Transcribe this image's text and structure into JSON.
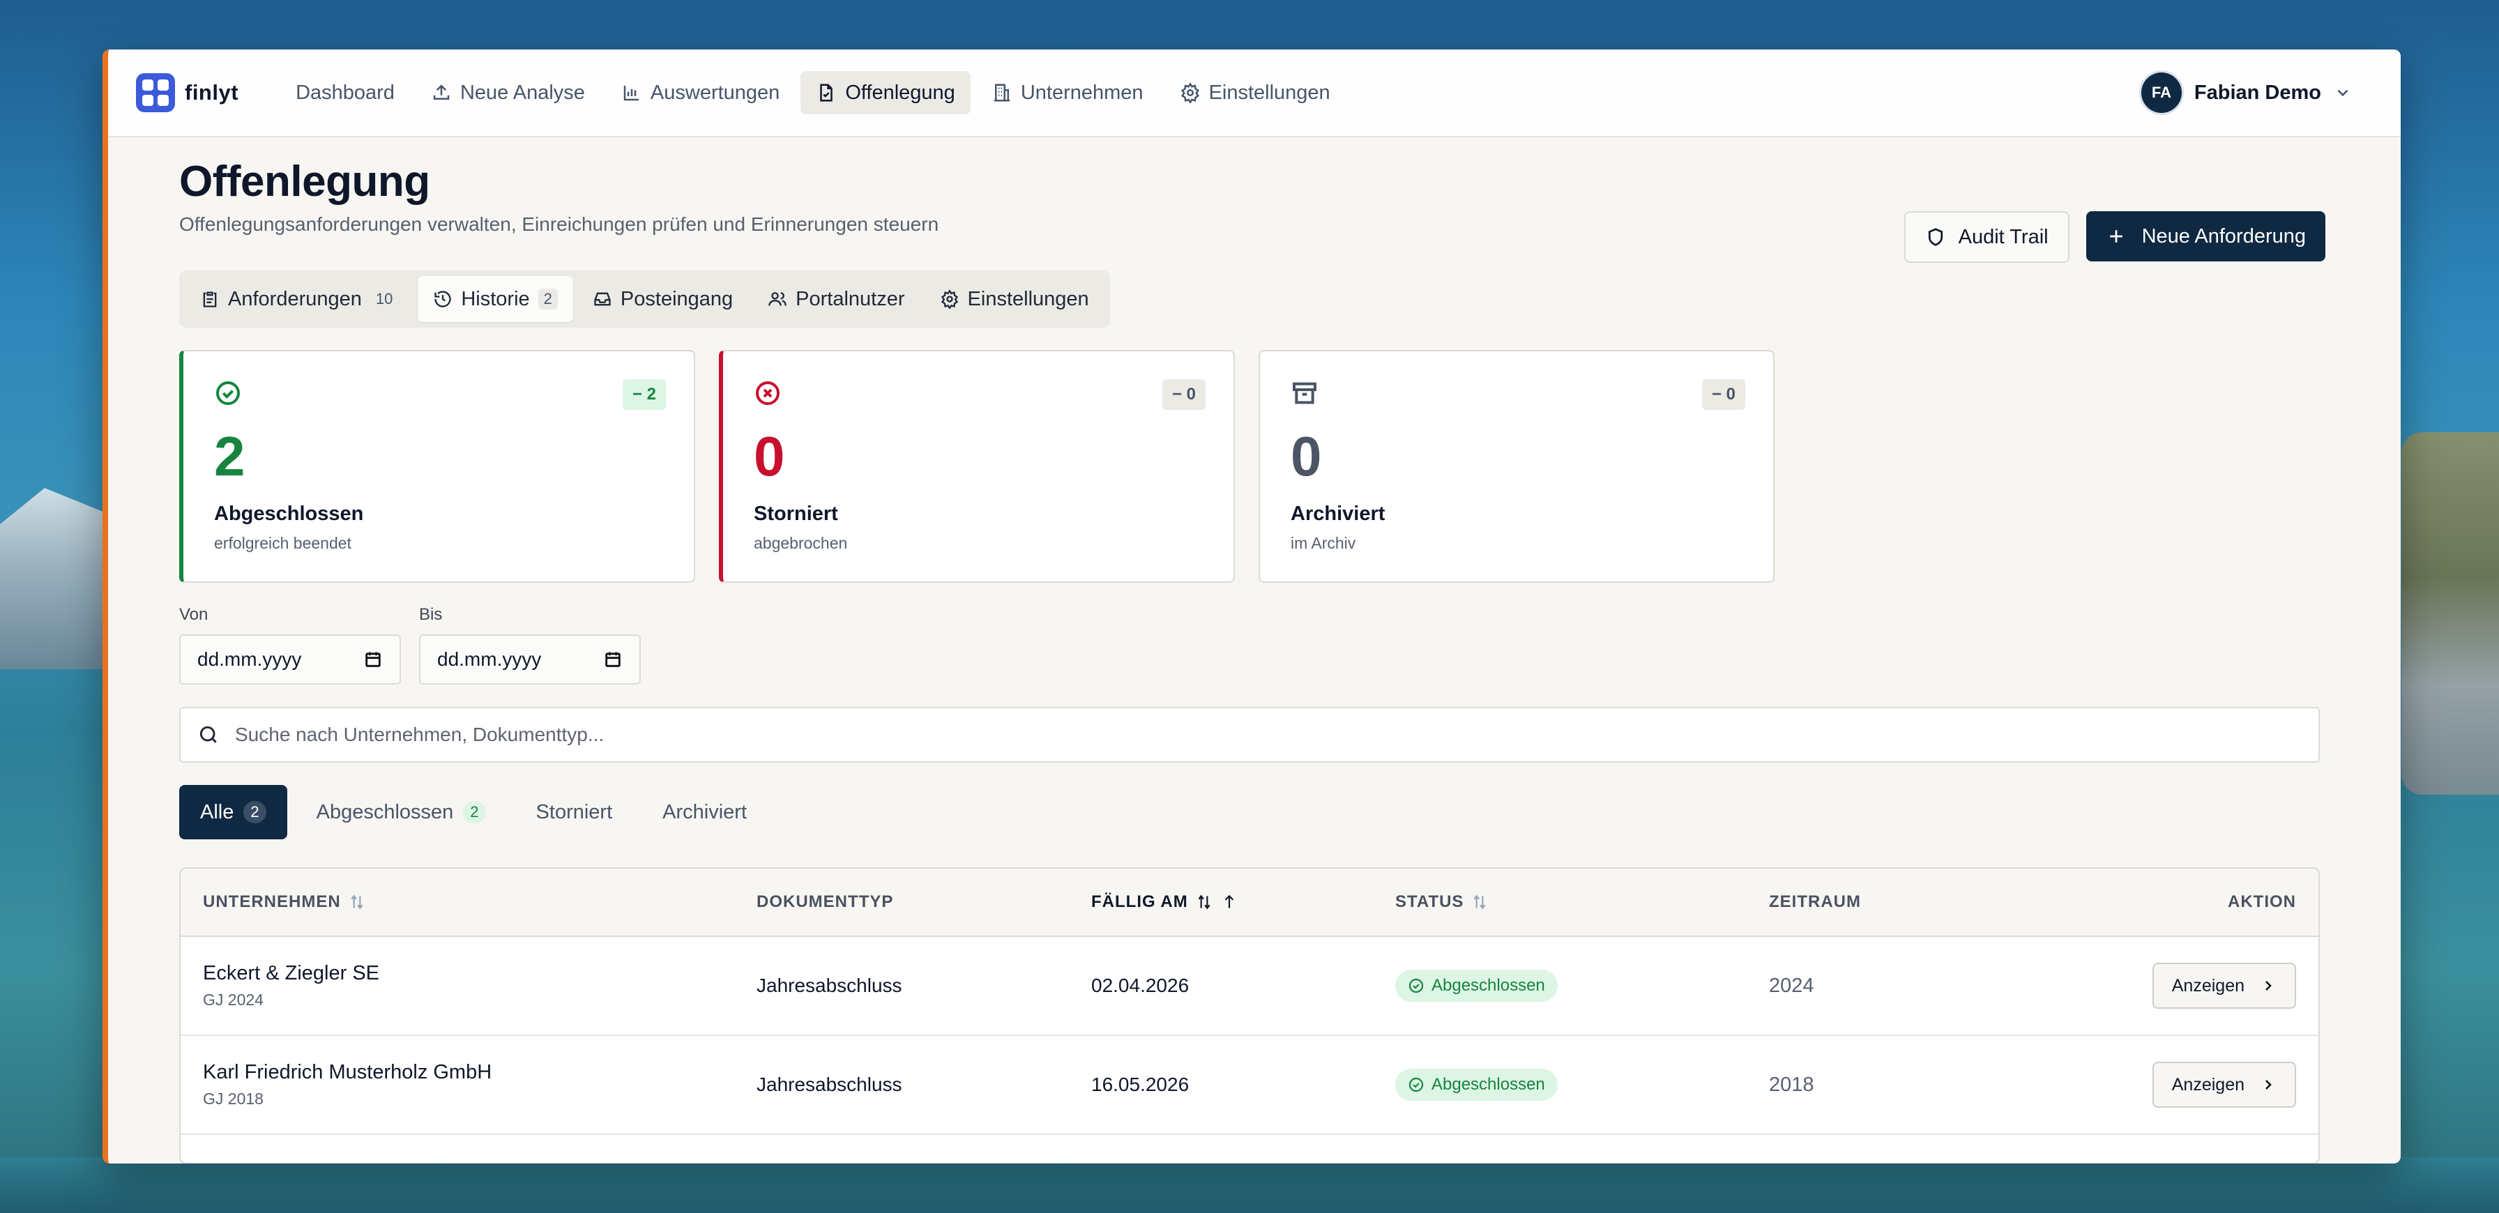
{
  "app": {
    "logo_text": "finlyt"
  },
  "nav": {
    "items": [
      {
        "label": "Dashboard",
        "icon": "none"
      },
      {
        "label": "Neue Analyse",
        "icon": "upload-icon"
      },
      {
        "label": "Auswertungen",
        "icon": "bar-chart-icon"
      },
      {
        "label": "Offenlegung",
        "icon": "file-check-icon",
        "active": true
      },
      {
        "label": "Unternehmen",
        "icon": "building-icon"
      },
      {
        "label": "Einstellungen",
        "icon": "gear-icon"
      }
    ]
  },
  "user": {
    "initials": "FA",
    "name": "Fabian Demo"
  },
  "page": {
    "title": "Offenlegung",
    "subtitle": "Offenlegungsanforderungen verwalten, Einreichungen prüfen und Erinnerungen steuern",
    "audit_label": "Audit Trail",
    "new_request_label": "Neue Anforderung"
  },
  "subtabs": [
    {
      "label": "Anforderungen",
      "count": "10"
    },
    {
      "label": "Historie",
      "count": "2",
      "active": true
    },
    {
      "label": "Posteingang",
      "count": ""
    },
    {
      "label": "Portalnutzer",
      "count": ""
    },
    {
      "label": "Einstellungen",
      "count": ""
    }
  ],
  "cards": [
    {
      "badge": "− 2",
      "value": "2",
      "label": "Abgeschlossen",
      "sub": "erfolgreich beendet",
      "color": "#16843f"
    },
    {
      "badge": "− 0",
      "value": "0",
      "label": "Storniert",
      "sub": "abgebrochen",
      "color": "#c8102e"
    },
    {
      "badge": "− 0",
      "value": "0",
      "label": "Archiviert",
      "sub": "im Archiv",
      "color": "#4b5563"
    }
  ],
  "dates": {
    "from_label": "Von",
    "from_value": "dd.mm.yyyy",
    "to_label": "Bis",
    "to_value": "dd.mm.yyyy"
  },
  "search": {
    "placeholder": "Suche nach Unternehmen, Dokumenttyp..."
  },
  "filters": [
    {
      "label": "Alle",
      "count": "2",
      "active": true
    },
    {
      "label": "Abgeschlossen",
      "count": "2"
    },
    {
      "label": "Storniert",
      "count": ""
    },
    {
      "label": "Archiviert",
      "count": ""
    }
  ],
  "table": {
    "headers": {
      "company": "UNTERNEHMEN",
      "doctype": "DOKUMENTTYP",
      "due": "FÄLLIG AM",
      "status": "STATUS",
      "period": "ZEITRAUM",
      "action": "AKTION"
    },
    "rows": [
      {
        "company": "Eckert & Ziegler SE",
        "fy": "GJ 2024",
        "doctype": "Jahresabschluss",
        "due": "02.04.2026",
        "status": "Abgeschlossen",
        "period": "2024",
        "action": "Anzeigen"
      },
      {
        "company": "Karl Friedrich Musterholz GmbH",
        "fy": "GJ 2018",
        "doctype": "Jahresabschluss",
        "due": "16.05.2026",
        "status": "Abgeschlossen",
        "period": "2018",
        "action": "Anzeigen"
      }
    ]
  },
  "colors": {
    "accent": "#0f2942",
    "success": "#16843f",
    "danger": "#c8102e",
    "brand": "#3b5bdb"
  }
}
